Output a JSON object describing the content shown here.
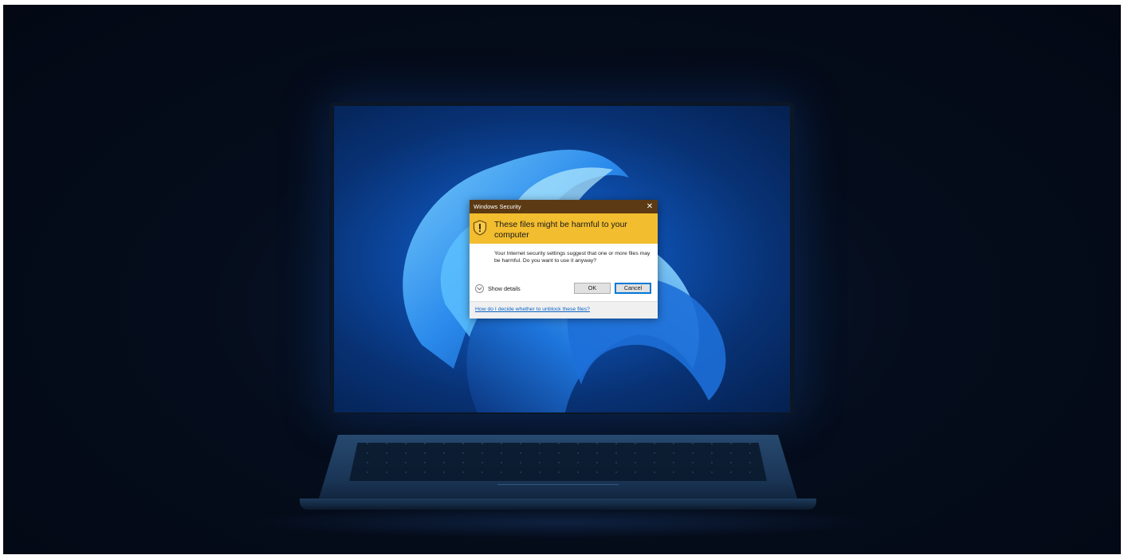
{
  "dialog": {
    "title": "Windows Security",
    "close_glyph": "✕",
    "heading": "These files might be harmful to your computer",
    "message": "Your Internet security settings suggest that one or more files may be harmful. Do you want to use it anyway?",
    "details_label": "Show details",
    "ok_label": "OK",
    "cancel_label": "Cancel",
    "help_link": "How do I decide whether to unblock these files?",
    "icons": {
      "warning": "warning-shield-icon",
      "details": "chevron-down-icon",
      "close": "close-icon"
    }
  },
  "colors": {
    "titlebar": "#5c3a14",
    "banner": "#f2bd2e",
    "link": "#0b63c4",
    "accent": "#0078d7",
    "wallpaper": "#1f7fe0"
  }
}
